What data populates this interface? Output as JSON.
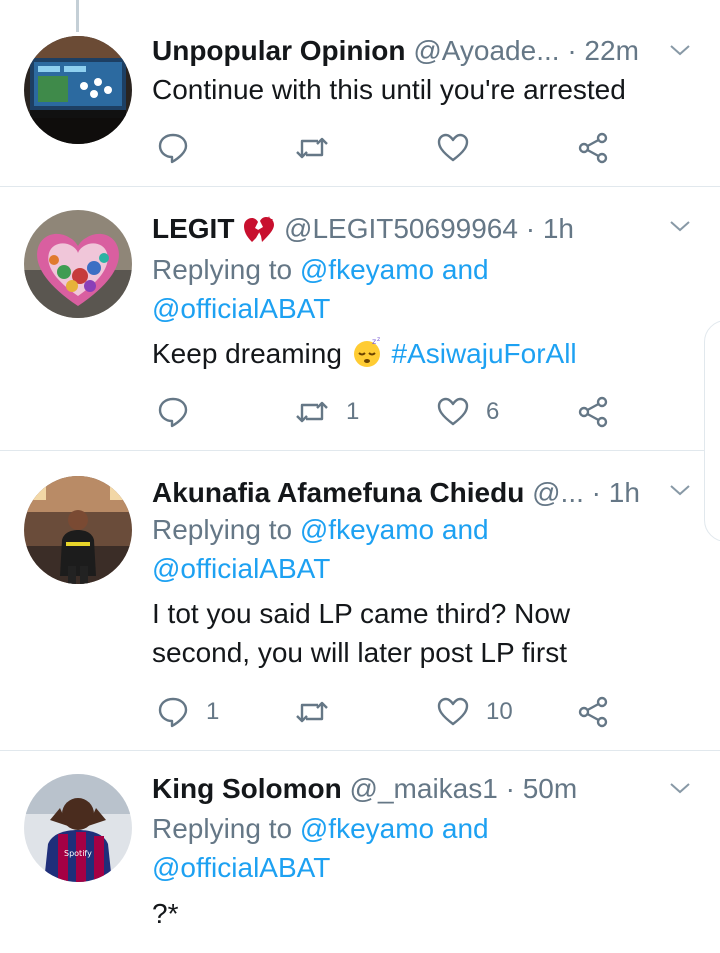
{
  "tweets": [
    {
      "name": "Unpopular Opinion",
      "handle": "@Ayoade...",
      "time": "· 22m",
      "replying_label": "",
      "mentions": "",
      "mentions2": "",
      "text": "Continue with this until you're arrested",
      "hashtag": "",
      "reply_count": "",
      "retweet_count": "",
      "like_count": ""
    },
    {
      "name": "LEGIT",
      "handle": "@LEGIT50699964",
      "time": "· 1h",
      "replying_label": "Replying to ",
      "mentions": "@fkeyamo and",
      "mentions2": "@officialABAT",
      "text": "Keep dreaming",
      "hashtag": "#AsiwajuForAll",
      "reply_count": "",
      "retweet_count": "1",
      "like_count": "6"
    },
    {
      "name": "Akunafia Afamefuna Chiedu",
      "handle": "@...",
      "time": "· 1h",
      "replying_label": "Replying to ",
      "mentions": "@fkeyamo and",
      "mentions2": "@officialABAT",
      "text_line1": "I tot you said LP came third? Now",
      "text_line2": "second, you will later post LP first",
      "reply_count": "1",
      "retweet_count": "",
      "like_count": "10"
    },
    {
      "name": "King Solomon",
      "handle": "@_maikas1",
      "time": "· 50m",
      "replying_label": "Replying to ",
      "mentions": "@fkeyamo and",
      "mentions2": "@officialABAT",
      "text": "?*"
    }
  ],
  "icons": {
    "reply": "reply-icon",
    "retweet": "retweet-icon",
    "like": "heart-icon",
    "share": "share-icon",
    "more": "chevron-down-icon"
  },
  "colors": {
    "link": "#1da1f2",
    "secondary": "#657786",
    "divider": "#e1e8ed"
  }
}
